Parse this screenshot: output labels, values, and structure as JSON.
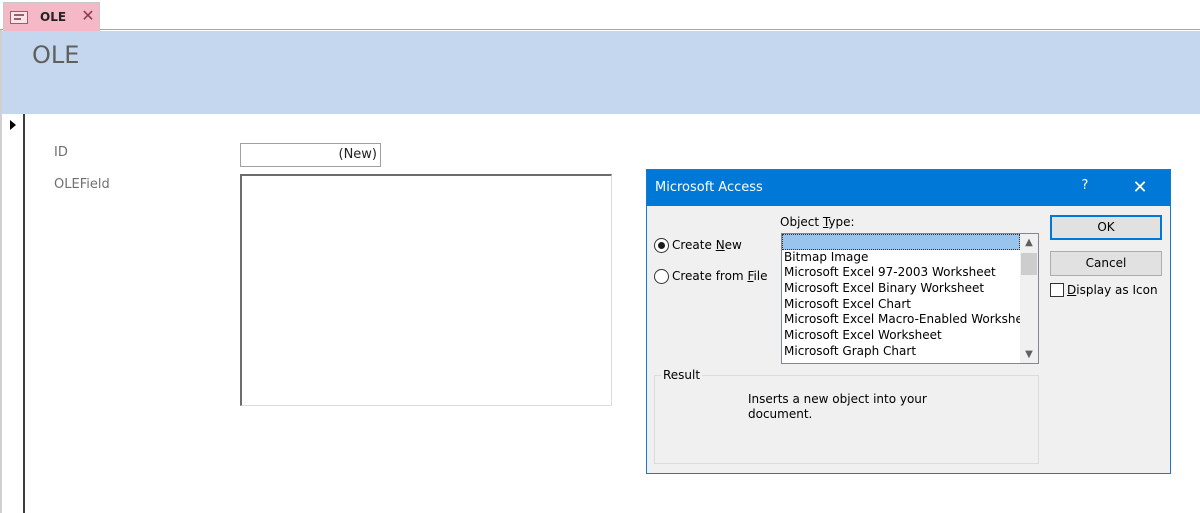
{
  "tab": {
    "title": "OLE",
    "close_glyph": "✕",
    "icon": "form-icon"
  },
  "form": {
    "title": "OLE",
    "fields": [
      {
        "label": "ID",
        "value": "(New)"
      },
      {
        "label": "OLEField",
        "value": ""
      }
    ]
  },
  "dialog": {
    "title": "Microsoft Access",
    "help_glyph": "?",
    "close_glyph": "✕",
    "create_new_label": "Create New",
    "create_from_file_label": "Create from File",
    "object_type_label": "Object Type:",
    "object_types": [
      "",
      "Bitmap Image",
      "Microsoft Excel 97-2003 Worksheet",
      "Microsoft Excel Binary Worksheet",
      "Microsoft Excel Chart",
      "Microsoft Excel Macro-Enabled Worksheet",
      "Microsoft Excel Worksheet",
      "Microsoft Graph Chart"
    ],
    "ok_label": "OK",
    "cancel_label": "Cancel",
    "display_as_icon_label": "Display as Icon",
    "result_label": "Result",
    "result_text": "Inserts a new  object into your document."
  },
  "colors": {
    "tab_bg": "#f4b8c6",
    "header_bg": "#c5d7ee",
    "dialog_titlebar": "#0078d7",
    "list_selection": "#99c4ee"
  }
}
